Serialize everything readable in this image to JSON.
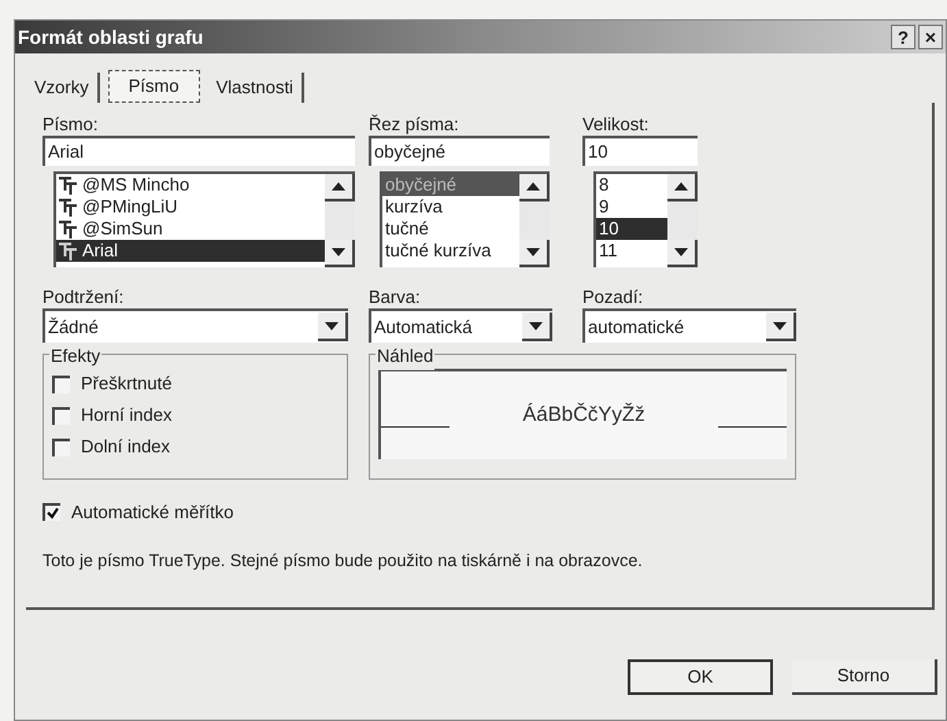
{
  "window": {
    "title": "Formát oblasti grafu",
    "help_button": "?",
    "close_button": "×"
  },
  "tabs": [
    {
      "label": "Vzorky",
      "selected": false
    },
    {
      "label": "Písmo",
      "selected": true
    },
    {
      "label": "Vlastnosti",
      "selected": false
    }
  ],
  "font": {
    "label": "Písmo:",
    "value": "Arial",
    "items": [
      {
        "label": "@MS Mincho",
        "selected": false
      },
      {
        "label": "@PMingLiU",
        "selected": false
      },
      {
        "label": "@SimSun",
        "selected": false
      },
      {
        "label": "Arial",
        "selected": true
      }
    ]
  },
  "font_style": {
    "label": "Řez písma:",
    "value": "obyčejné",
    "items": [
      {
        "label": "obyčejné",
        "selected": true
      },
      {
        "label": "kurzíva",
        "selected": false
      },
      {
        "label": "tučné",
        "selected": false
      },
      {
        "label": "tučné kurzíva",
        "selected": false
      }
    ]
  },
  "size": {
    "label": "Velikost:",
    "value": "10",
    "items": [
      {
        "label": "8",
        "selected": false
      },
      {
        "label": "9",
        "selected": false
      },
      {
        "label": "10",
        "selected": true
      },
      {
        "label": "11",
        "selected": false
      }
    ]
  },
  "underline": {
    "label": "Podtržení:",
    "value": "Žádné"
  },
  "color": {
    "label": "Barva:",
    "value": "Automatická"
  },
  "background": {
    "label": "Pozadí:",
    "value": "automatické"
  },
  "effects": {
    "title": "Efekty",
    "items": [
      {
        "label": "Přeškrtnuté",
        "checked": false
      },
      {
        "label": "Horní index",
        "checked": false
      },
      {
        "label": "Dolní index",
        "checked": false
      }
    ]
  },
  "preview": {
    "title": "Náhled",
    "sample": "ÁáBbČčYyŽž"
  },
  "auto_scale": {
    "label": "Automatické měřítko",
    "checked": true
  },
  "info": "Toto je písmo TrueType. Stejné písmo bude použito na tiskárně i na obrazovce.",
  "buttons": [
    {
      "label": "OK",
      "default": true
    },
    {
      "label": "Storno",
      "default": false
    }
  ]
}
